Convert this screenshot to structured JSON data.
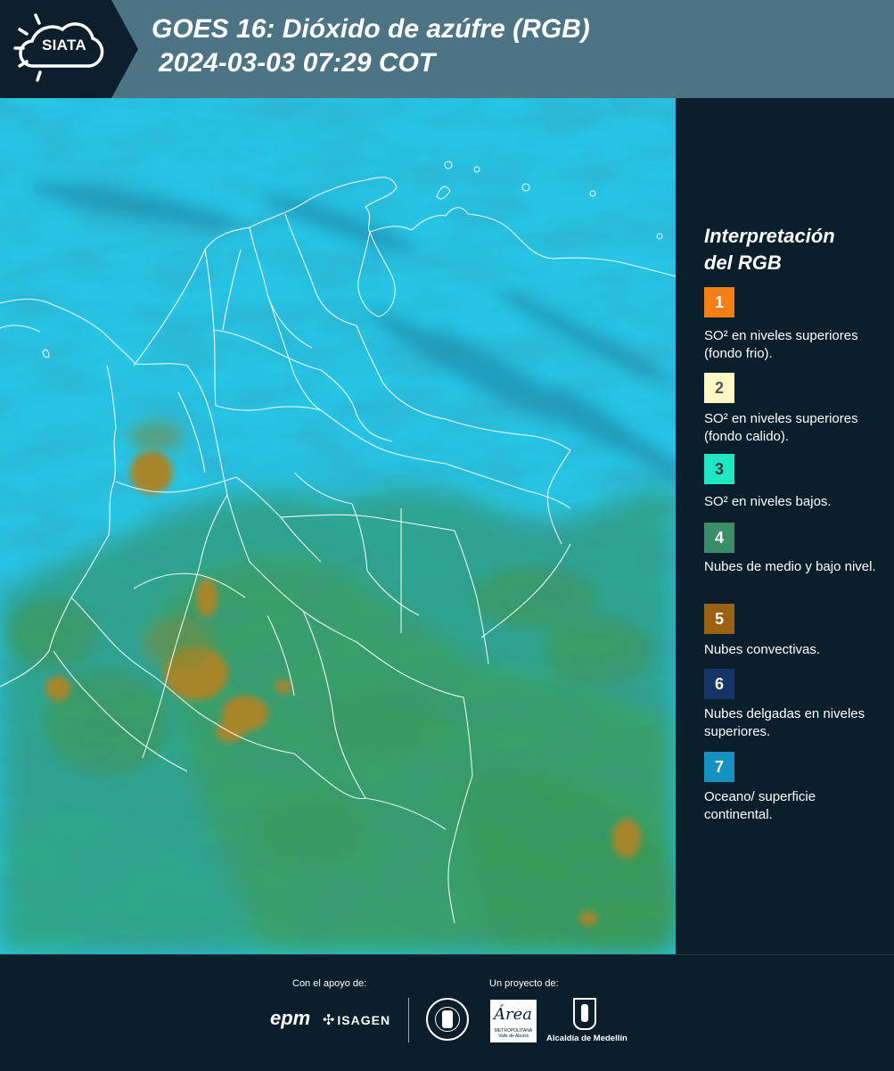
{
  "header": {
    "logo_text": "SIATA",
    "title_line1": "GOES 16: Dióxido de azúfre (RGB)",
    "title_line2": "2024-03-03 07:29 COT",
    "bg_color": "#4d7484",
    "logo_bg_color": "#0d1f2d"
  },
  "legend": {
    "title_line1": "Interpretación",
    "title_line2": "del RGB",
    "items": [
      {
        "number": "1",
        "color": "#f57f17",
        "number_color": "#ffffff",
        "label": "SO² en niveles superiores (fondo frio)."
      },
      {
        "number": "2",
        "color": "#fff7c4",
        "number_color": "#555555",
        "label": "SO² en niveles superiores (fondo calido)."
      },
      {
        "number": "3",
        "color": "#1ee8c4",
        "number_color": "#333333",
        "label": "SO² en niveles bajos."
      },
      {
        "number": "4",
        "color": "#3a8e67",
        "number_color": "#ffffff",
        "label": "Nubes de medio y bajo nivel."
      },
      {
        "number": "5",
        "color": "#9a6112",
        "number_color": "#ffffff",
        "label": "Nubes convectivas."
      },
      {
        "number": "6",
        "color": "#163466",
        "number_color": "#ffffff",
        "label": "Nubes delgadas en niveles superiores."
      },
      {
        "number": "7",
        "color": "#1592c2",
        "number_color": "#ffffff",
        "label": "Oceano/ superficie continental."
      }
    ]
  },
  "footer": {
    "support_label": "Con el apoyo de:",
    "project_label": "Un proyecto de:",
    "epm_logo": "epm",
    "isagen_logo": "ISAGEN",
    "area_logo": "Área",
    "area_sub": "METROPOLITANA Valle de Aburrá",
    "alcaldia_logo": "Alcaldía de Medellín"
  },
  "map": {
    "product": "GOES 16 SO2 RGB",
    "region": "Colombia",
    "ocean_color": "#28c6e6",
    "land_color": "#2aa49a",
    "cloud_green_color": "#33a067",
    "convective_color": "#a5862e",
    "border_color": "#ffffff"
  }
}
